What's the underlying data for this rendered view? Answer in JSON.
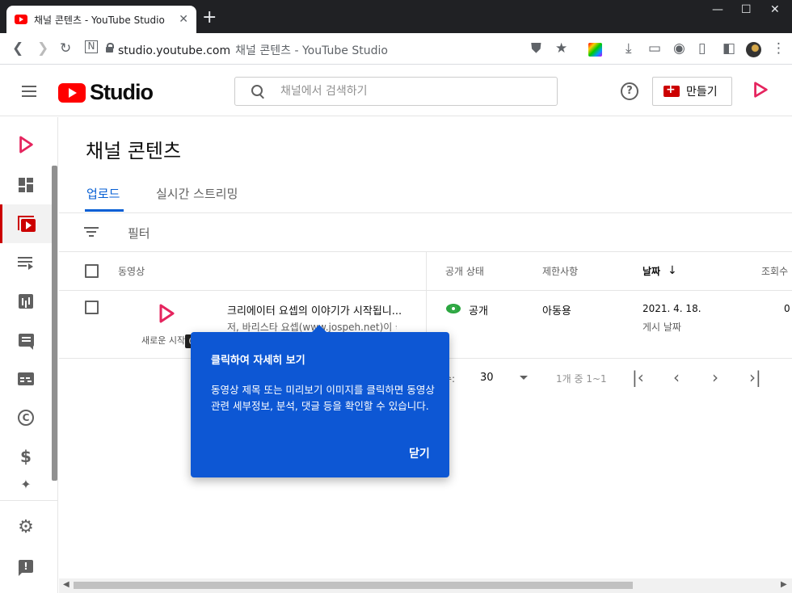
{
  "browser": {
    "tab_title": "채널 콘텐츠 - YouTube Studio",
    "tab_close": "✕",
    "new_tab": "+",
    "win_minimize": "—",
    "win_maximize": "☐",
    "win_close": "✕",
    "url_domain": "studio.youtube.com",
    "url_page": "채널 콘텐츠 - YouTube Studio"
  },
  "header": {
    "logo_text": "Studio",
    "search_placeholder": "채널에서 검색하기",
    "help": "?",
    "create_label": "만들기"
  },
  "page": {
    "title": "채널 콘텐츠",
    "tabs": [
      {
        "label": "업로드",
        "active": true
      },
      {
        "label": "실시간 스트리밍",
        "active": false
      }
    ],
    "filter_label": "필터"
  },
  "table": {
    "headers": {
      "video": "동영상",
      "visibility": "공개 상태",
      "restrictions": "제한사항",
      "date": "날짜",
      "views": "조회수"
    },
    "rows": [
      {
        "thumb_caption": "새로운 시작",
        "duration": "0",
        "title": "크리에이터 요셉의 이야기가 시작됩니...",
        "description": "저, 바리스타 요셉(www.jospeh.net)이 국비",
        "visibility": "공개",
        "restrictions": "아동용",
        "date": "2021. 4. 18.",
        "date_sub": "게시 날짜",
        "views": "0"
      }
    ]
  },
  "pagination": {
    "rows_label": "수:",
    "rows_value": "30",
    "range": "1개 중 1~1"
  },
  "popup": {
    "title": "클릭하여 자세히 보기",
    "body": "동영상 제목 또는 미리보기 이미지를 클릭하면 동영상 관련 세부정보, 분석, 댓글 등을 확인할 수 있습니다.",
    "close": "닫기"
  },
  "colors": {
    "accent_blue": "#065fd4",
    "brand_red": "#ff0000",
    "popup_bg": "#0d57d4",
    "public_green": "#2ba640",
    "channel_pink": "#e5245e"
  }
}
